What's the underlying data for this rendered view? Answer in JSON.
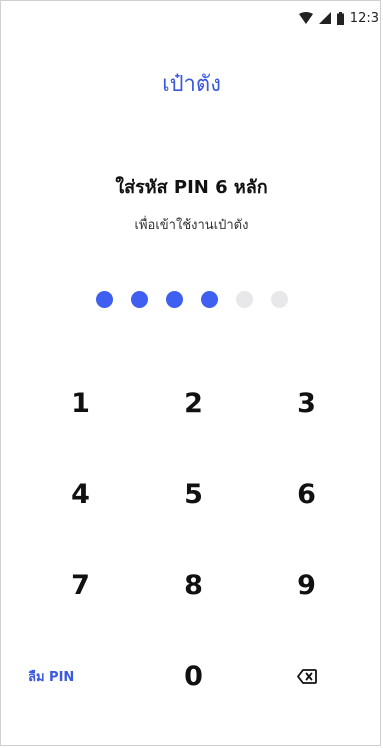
{
  "status_bar": {
    "time": "12:3",
    "icons": [
      "wifi-icon",
      "cell-signal-icon",
      "battery-icon"
    ]
  },
  "app": {
    "title": "เป๋าตัง"
  },
  "pin_prompt": {
    "heading": "ใส่รหัส PIN 6 หลัก",
    "subtitle": "เพื่อเข้าใช้งานเป๋าตัง",
    "total_digits": 6,
    "entered_digits": 4
  },
  "keypad": {
    "keys": [
      "1",
      "2",
      "3",
      "4",
      "5",
      "6",
      "7",
      "8",
      "9"
    ],
    "forgot_label": "ลืม PIN",
    "zero": "0",
    "backspace_icon": "backspace-icon"
  },
  "colors": {
    "accent": "#3e5ff0",
    "dot_empty": "#e8e8ea"
  }
}
